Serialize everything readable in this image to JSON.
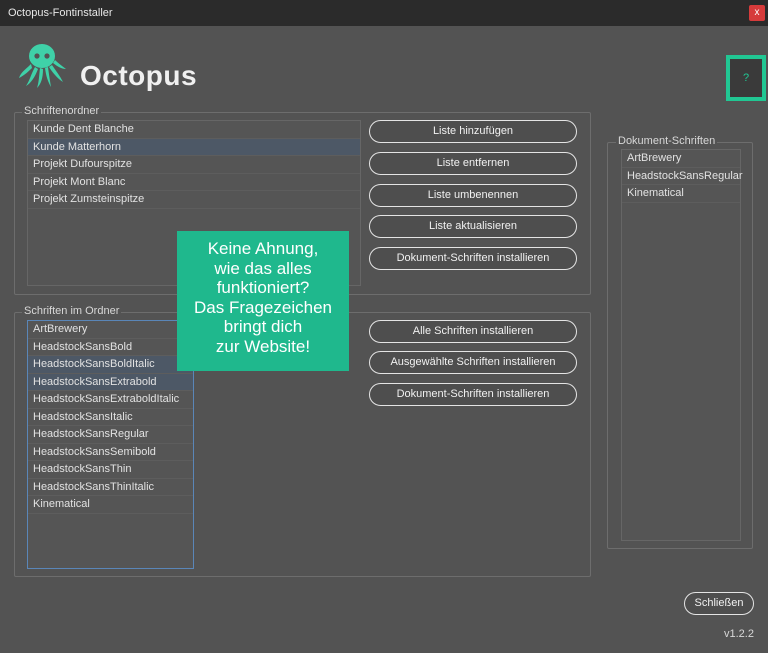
{
  "window": {
    "title": "Octopus-Fontinstaller",
    "close_label": "x"
  },
  "app": {
    "title": "Octopus",
    "help_label": "?"
  },
  "folders": {
    "label": "Schriftenordner",
    "items": [
      "Kunde Dent Blanche",
      "Kunde Matterhorn",
      "Projekt Dufourspitze",
      "Projekt Mont Blanc",
      "Projekt Zumsteinspitze"
    ],
    "selected": "Kunde Matterhorn",
    "buttons": {
      "add": "Liste hinzufügen",
      "remove": "Liste entfernen",
      "rename": "Liste umbenennen",
      "refresh": "Liste aktualisieren",
      "install_doc": "Dokument-Schriften installieren"
    }
  },
  "fonts": {
    "label": "Schriften im Ordner",
    "items": [
      "ArtBrewery",
      "HeadstockSansBold",
      "HeadstockSansBoldItalic",
      "HeadstockSansExtrabold",
      "HeadstockSansExtraboldItalic",
      "HeadstockSansItalic",
      "HeadstockSansRegular",
      "HeadstockSansSemibold",
      "HeadstockSansThin",
      "HeadstockSansThinItalic",
      "Kinematical"
    ],
    "selected": [
      "HeadstockSansBoldItalic",
      "HeadstockSansExtrabold"
    ],
    "buttons": {
      "install_all": "Alle Schriften installieren",
      "install_selected": "Ausgewählte Schriften installieren",
      "install_doc": "Dokument-Schriften installieren"
    }
  },
  "document_fonts": {
    "label": "Dokument-Schriften",
    "items": [
      "ArtBrewery",
      "HeadstockSansRegular",
      "Kinematical"
    ]
  },
  "tooltip": {
    "lines": [
      "Keine Ahnung,",
      "wie das alles",
      "funktioniert?",
      "Das Fragezeichen",
      "bringt dich",
      "zur Website!"
    ]
  },
  "footer": {
    "close_label": "Schließen",
    "version": "v1.2.2"
  },
  "colors": {
    "accent": "#21c793",
    "background": "#535353",
    "titlebar": "#2b2b2b",
    "selection": "#4d5866"
  }
}
